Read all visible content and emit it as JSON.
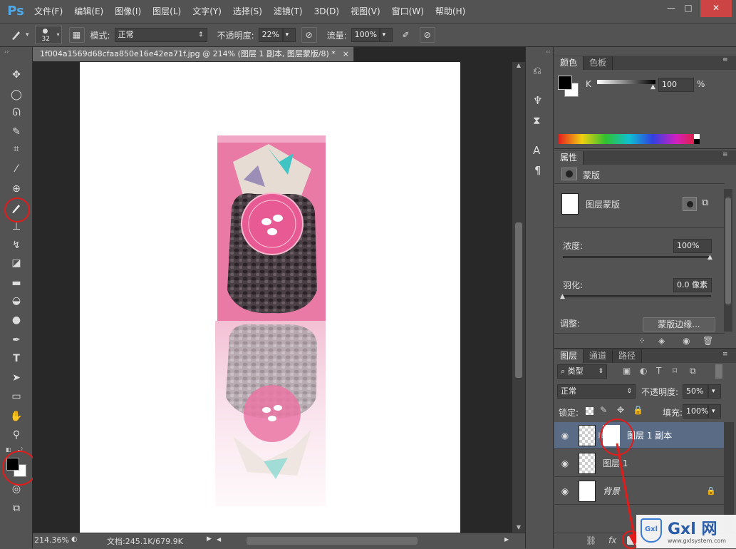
{
  "app": {
    "logo": "Ps"
  },
  "menu": [
    "文件(F)",
    "编辑(E)",
    "图像(I)",
    "图层(L)",
    "文字(Y)",
    "选择(S)",
    "滤镜(T)",
    "3D(D)",
    "视图(V)",
    "窗口(W)",
    "帮助(H)"
  ],
  "window_controls": {
    "minimize": "—",
    "maximize": "□",
    "close": "✕"
  },
  "options": {
    "brush_size": "32",
    "mode_label": "模式:",
    "mode_value": "正常",
    "opacity_label": "不透明度:",
    "opacity_value": "22%",
    "flow_label": "流量:",
    "flow_value": "100%"
  },
  "document": {
    "tab_title": "1f004a1569d68cfaa850e16e42ea71f.jpg @ 214% (图层 1 副本, 图层蒙版/8) *",
    "close": "×",
    "zoom": "214.36%",
    "doc_info": "文档:245.1K/679.9K"
  },
  "color_panel": {
    "tabs": [
      "颜色",
      "色板"
    ],
    "channel": "K",
    "value": "100",
    "unit": "%"
  },
  "properties_panel": {
    "tab": "属性",
    "mask_title": "蒙版",
    "layer_mask_label": "图层蒙版",
    "density_label": "浓度:",
    "density_value": "100%",
    "feather_label": "羽化:",
    "feather_value": "0.0 像素",
    "adjust_label": "调整:",
    "mask_edge_button": "蒙版边缘..."
  },
  "layers_panel": {
    "tabs": [
      "图层",
      "通道",
      "路径"
    ],
    "filter_kind": "类型",
    "blend_mode": "正常",
    "opacity_label": "不透明度:",
    "opacity_value": "50%",
    "lock_label": "锁定:",
    "fill_label": "填充:",
    "fill_value": "100%",
    "layers": [
      {
        "name": "图层 1 副本",
        "selected": true
      },
      {
        "name": "图层 1",
        "selected": false
      },
      {
        "name": "背景",
        "selected": false,
        "locked": true
      }
    ]
  },
  "watermark": {
    "brand": "Gxl 网",
    "url": "www.gxlsystem.com"
  },
  "colors": {
    "accent": "#4fa8e8",
    "annotation": "#e21b1b",
    "pink": "#e97aa6",
    "selected_layer": "#5a6b85"
  }
}
